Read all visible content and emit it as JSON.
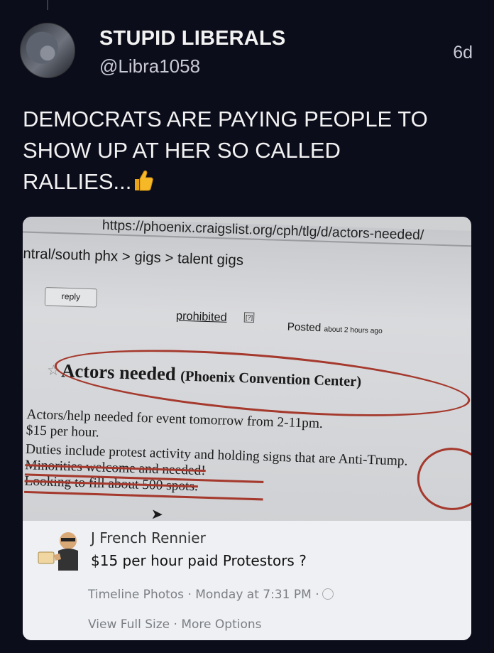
{
  "post": {
    "display_name": "STUPID LIBERALS",
    "handle": "@Libra1058",
    "time_ago": "6d",
    "text": "DEMOCRATS ARE PAYING PEOPLE TO\nSHOW UP AT HER SO CALLED\nRALLIES...",
    "emoji_icon": "thumbs-up-icon"
  },
  "photo": {
    "url_text": "https://phoenix.craigslist.org/cph/tlg/d/actors-needed/",
    "breadcrumb": "ntral/south phx > gigs > talent gigs",
    "reply_label": "reply",
    "prohibited_label": "prohibited",
    "flag_label": "[?]",
    "posted_label": "Posted",
    "posted_time": "about 2 hours ago",
    "ad_title": "Actors needed",
    "ad_location": "(Phoenix Convention Center)",
    "body_lines": [
      "Actors/help needed for event tomorrow from 2-11pm.",
      "$15 per hour.",
      "Duties include protest activity and holding signs that are Anti-Trump.",
      "Minorities welcome and needed!",
      "Looking to fill about 500 spots."
    ],
    "annotation_color": "#a5392d"
  },
  "facebook": {
    "commenter_name": "J French Rennier",
    "message": "$15 per hour paid Protestors ?",
    "meta_source": "Timeline Photos",
    "meta_time": "Monday at 7:31 PM",
    "option_view": "View Full Size",
    "option_more": "More Options",
    "separator": "·"
  }
}
